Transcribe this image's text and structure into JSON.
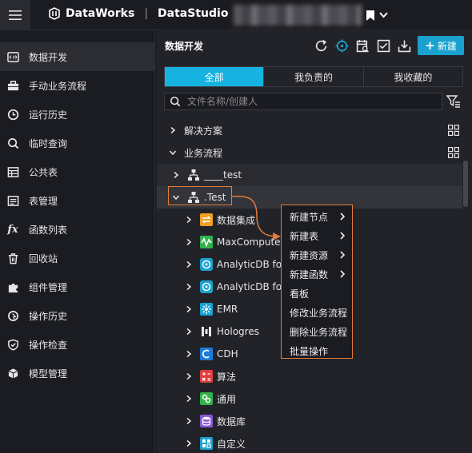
{
  "header": {
    "brand": "DataWorks",
    "separator": "|",
    "module": "DataStudio"
  },
  "sidebar": {
    "items": [
      {
        "label": "数据开发",
        "icon": "code-icon"
      },
      {
        "label": "手动业务流程",
        "icon": "briefcase-icon"
      },
      {
        "label": "运行历史",
        "icon": "clock-icon"
      },
      {
        "label": "临时查询",
        "icon": "search-icon"
      },
      {
        "label": "公共表",
        "icon": "table-icon"
      },
      {
        "label": "表管理",
        "icon": "table-manage-icon"
      },
      {
        "label": "函数列表",
        "icon": "function-icon"
      },
      {
        "label": "回收站",
        "icon": "trash-icon"
      },
      {
        "label": "组件管理",
        "icon": "puzzle-icon"
      },
      {
        "label": "操作历史",
        "icon": "history-icon"
      },
      {
        "label": "操作检查",
        "icon": "shield-check-icon"
      },
      {
        "label": "模型管理",
        "icon": "cube-icon"
      }
    ]
  },
  "panel": {
    "title": "数据开发",
    "new_button": "新建",
    "new_plus": "+",
    "tabs": [
      "全部",
      "我负责的",
      "我收藏的"
    ],
    "search_placeholder": "文件名称/创建人"
  },
  "tree": {
    "solutions": "解决方案",
    "business_flow": "业务流程",
    "flows": [
      "____test",
      ".Test"
    ],
    "nodes": [
      {
        "label": "数据集成",
        "icon": "data-integration-icon",
        "color": "#f0a020"
      },
      {
        "label": "MaxCompute",
        "icon": "maxcompute-icon",
        "color": "#32b24a"
      },
      {
        "label": "AnalyticDB for Po",
        "icon": "analyticdb-icon",
        "color": "#1aa1cf"
      },
      {
        "label": "AnalyticDB for M",
        "icon": "analyticdb-icon",
        "color": "#1aa1cf"
      },
      {
        "label": "EMR",
        "icon": "emr-icon",
        "color": "#1aa1cf"
      },
      {
        "label": "Hologres",
        "icon": "hologres-icon",
        "color": "#ffffff"
      },
      {
        "label": "CDH",
        "icon": "cdh-icon",
        "color": "#1a7bd8"
      },
      {
        "label": "算法",
        "icon": "algorithm-icon",
        "color": "#e23d3d"
      },
      {
        "label": "通用",
        "icon": "general-icon",
        "color": "#32b24a"
      },
      {
        "label": "数据库",
        "icon": "database-icon",
        "color": "#8a57d6"
      },
      {
        "label": "自定义",
        "icon": "custom-icon",
        "color": "#1aa1cf"
      }
    ]
  },
  "context_menu": {
    "items": [
      {
        "label": "新建节点",
        "submenu": true
      },
      {
        "label": "新建表",
        "submenu": true
      },
      {
        "label": "新建资源",
        "submenu": true
      },
      {
        "label": "新建函数",
        "submenu": true
      },
      {
        "label": "看板",
        "submenu": false
      },
      {
        "label": "修改业务流程",
        "submenu": false
      },
      {
        "label": "删除业务流程",
        "submenu": false
      },
      {
        "label": "批量操作",
        "submenu": false
      }
    ]
  },
  "colors": {
    "accent": "#17b3e0",
    "highlight": "#e57a3a",
    "background": "#1e1f24"
  }
}
